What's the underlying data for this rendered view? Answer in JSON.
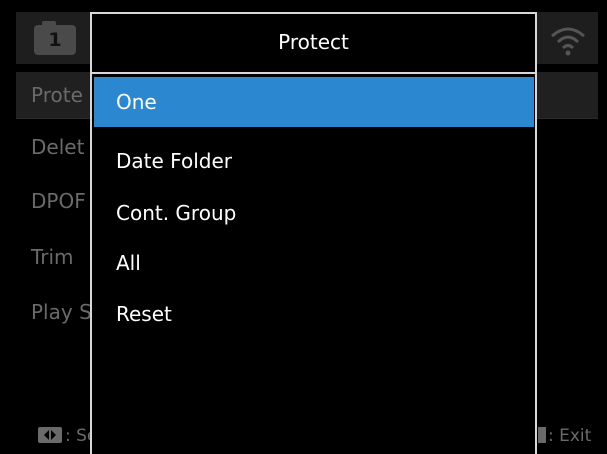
{
  "header": {
    "tab_number": "1"
  },
  "background_menu": {
    "items": [
      "Prote",
      "Delet",
      "DPOF",
      "Trim",
      "Play S"
    ]
  },
  "footer": {
    "left_label": ": Se",
    "right_label": ": Exit"
  },
  "dialog": {
    "title": "Protect",
    "selected_index": 0,
    "options": [
      "One",
      "Date Folder",
      "Cont. Group",
      "All",
      "Reset"
    ]
  },
  "colors": {
    "highlight": "#2b88d0",
    "border": "#d8d8d8",
    "dim_text": "#6a6a6a"
  },
  "icons": {
    "tab": "playback-tab-icon",
    "wifi": "wifi-icon",
    "dpad": "dpad-icon",
    "menu_key": "menu-key-icon"
  }
}
